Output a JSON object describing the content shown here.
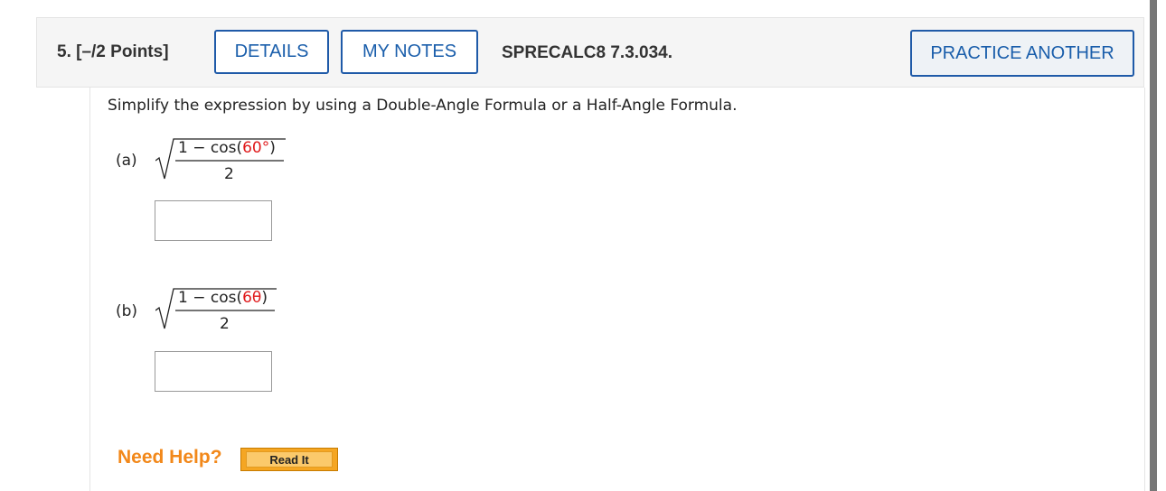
{
  "header": {
    "question_number": "5. [–/2 Points]",
    "details_label": "DETAILS",
    "my_notes_label": "MY NOTES",
    "question_ref": "SPRECALC8 7.3.034.",
    "practice_another_label": "PRACTICE ANOTHER"
  },
  "question": {
    "prompt": "Simplify the expression by using a Double-Angle Formula or a Half-Angle Formula.",
    "parts": [
      {
        "label": "(a)",
        "numerator_prefix": "1 − cos(",
        "numerator_highlight": "60°",
        "numerator_suffix": ")",
        "denominator": "2",
        "answer_value": ""
      },
      {
        "label": "(b)",
        "numerator_prefix": "1 − cos(",
        "numerator_highlight": "6θ",
        "numerator_suffix": ")",
        "denominator": "2",
        "answer_value": ""
      }
    ]
  },
  "help": {
    "need_help_label": "Need Help?",
    "read_it_label": "Read It"
  },
  "colors": {
    "accent_blue": "#1a5eab",
    "highlight_red": "#e0191b",
    "help_orange": "#f2881a"
  }
}
